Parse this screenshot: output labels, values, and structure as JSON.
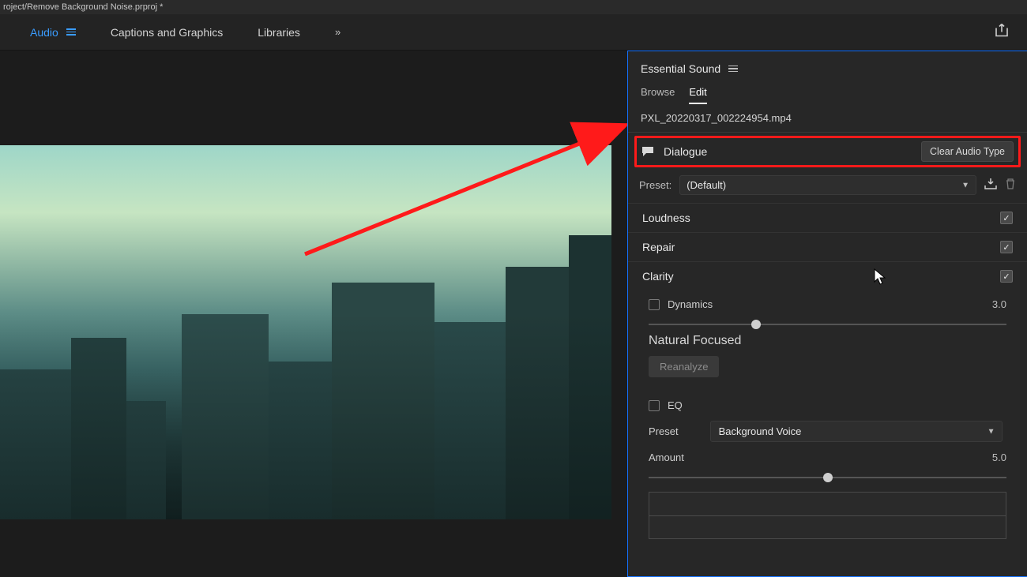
{
  "titlebar": "roject/Remove Background Noise.prproj *",
  "workspaces": {
    "audio": "Audio",
    "captions": "Captions and Graphics",
    "libraries": "Libraries"
  },
  "panel": {
    "title": "Essential Sound",
    "tabs": {
      "browse": "Browse",
      "edit": "Edit"
    },
    "clipname": "PXL_20220317_002224954.mp4",
    "audio_type": {
      "label": "Dialogue",
      "clear_btn": "Clear Audio Type"
    },
    "preset": {
      "label": "Preset:",
      "value": "(Default)"
    },
    "sections": {
      "loudness": "Loudness",
      "repair": "Repair",
      "clarity": "Clarity"
    },
    "dynamics": {
      "label": "Dynamics",
      "value": "3.0",
      "min_label": "Natural",
      "max_label": "Focused",
      "reanalyze": "Reanalyze"
    },
    "eq": {
      "label": "EQ",
      "preset_label": "Preset",
      "preset_value": "Background Voice",
      "amount_label": "Amount",
      "amount_value": "5.0"
    }
  }
}
